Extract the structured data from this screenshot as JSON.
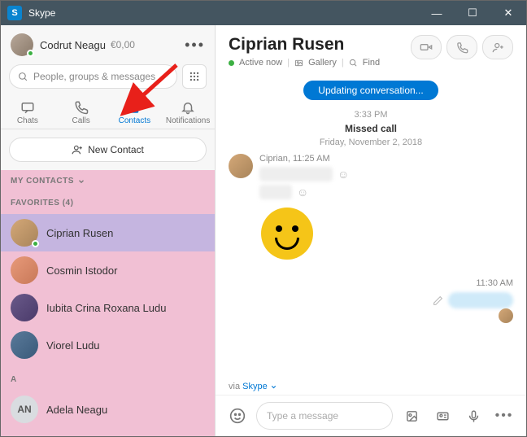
{
  "titlebar": {
    "app_name": "Skype"
  },
  "profile": {
    "name": "Codrut Neagu",
    "balance": "€0,00"
  },
  "search": {
    "placeholder": "People, groups & messages"
  },
  "nav": {
    "chats": "Chats",
    "calls": "Calls",
    "contacts": "Contacts",
    "notifications": "Notifications"
  },
  "sidebar": {
    "new_contact": "New Contact",
    "my_contacts": "MY CONTACTS",
    "favorites_label": "FAVORITES (4)",
    "section_a": "A",
    "favorites": [
      {
        "name": "Ciprian Rusen"
      },
      {
        "name": "Cosmin Istodor"
      },
      {
        "name": "Iubita Crina Roxana Ludu"
      },
      {
        "name": "Viorel Ludu"
      }
    ],
    "a_contacts": [
      {
        "initials": "AN",
        "name": "Adela Neagu"
      }
    ]
  },
  "conversation": {
    "title": "Ciprian Rusen",
    "status": "Active now",
    "gallery": "Gallery",
    "find": "Find",
    "updating": "Updating conversation...",
    "time1": "3:33 PM",
    "missed": "Missed call",
    "date": "Friday, November 2, 2018",
    "sender_line": "Ciprian, 11:25 AM",
    "out_time": "11:30 AM",
    "via": "via",
    "via_link": "Skype"
  },
  "compose": {
    "placeholder": "Type a message"
  }
}
